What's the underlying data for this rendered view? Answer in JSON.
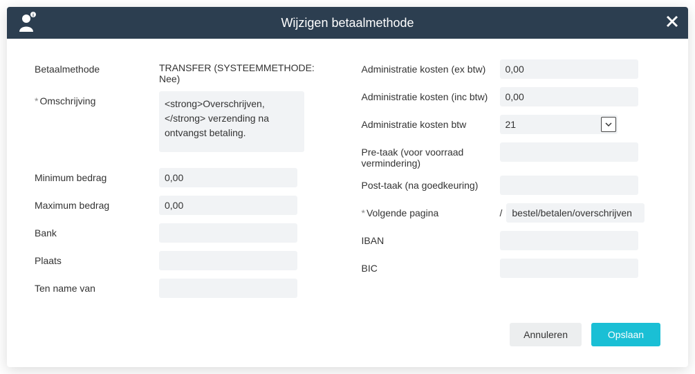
{
  "header": {
    "title": "Wijzigen betaalmethode"
  },
  "left": {
    "betaalmethode": {
      "label": "Betaalmethode",
      "value": "TRANSFER (SYSTEEMMETHODE: Nee)"
    },
    "omschrijving": {
      "label": "Omschrijving",
      "value": "<strong>Overschrijven,</strong> verzending na ontvangst betaling."
    },
    "min_bedrag": {
      "label": "Minimum bedrag",
      "value": "0,00"
    },
    "max_bedrag": {
      "label": "Maximum bedrag",
      "value": "0,00"
    },
    "bank": {
      "label": "Bank",
      "value": ""
    },
    "plaats": {
      "label": "Plaats",
      "value": ""
    },
    "tnv": {
      "label": "Ten name van",
      "value": ""
    }
  },
  "right": {
    "admin_ex": {
      "label": "Administratie kosten (ex btw)",
      "value": "0,00"
    },
    "admin_inc": {
      "label": "Administratie kosten (inc btw)",
      "value": "0,00"
    },
    "admin_btw": {
      "label": "Administratie kosten btw",
      "value": "21"
    },
    "pretask": {
      "label": "Pre-taak (voor voorraad vermindering)",
      "value": ""
    },
    "posttask": {
      "label": "Post-taak (na goedkeuring)",
      "value": ""
    },
    "nextpage": {
      "label": "Volgende pagina",
      "prefix": "/",
      "value": "bestel/betalen/overschrijven"
    },
    "iban": {
      "label": "IBAN",
      "value": ""
    },
    "bic": {
      "label": "BIC",
      "value": ""
    }
  },
  "footer": {
    "cancel": "Annuleren",
    "save": "Opslaan"
  }
}
